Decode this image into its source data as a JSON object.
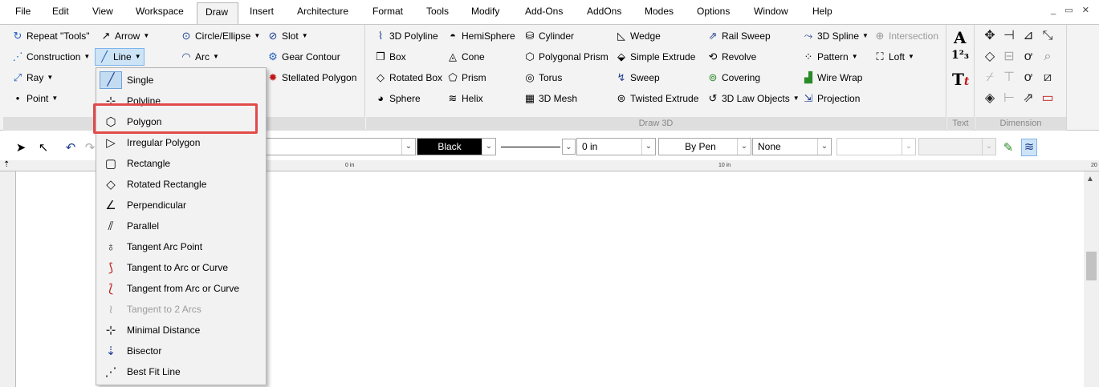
{
  "menubar": {
    "items": [
      "File",
      "Edit",
      "View",
      "Workspace",
      "Draw",
      "Insert",
      "Architecture",
      "Format",
      "Tools",
      "Modify",
      "Add-Ons",
      "AddOns",
      "Modes",
      "Options",
      "Window",
      "Help"
    ],
    "active": "Draw",
    "window_controls": "_ ▭ ✕"
  },
  "ribbon": {
    "draw2d": {
      "repeat": "Repeat \"Tools\"",
      "construction": "Construction",
      "ray": "Ray",
      "point": "Point",
      "arrow": "Arrow",
      "line": "Line",
      "circle": "Circle/Ellipse",
      "arc": "Arc",
      "slot": "Slot",
      "gear": "Gear Contour",
      "stellated": "Stellated Polygon"
    },
    "draw3d": {
      "label": "Draw 3D",
      "col1": [
        "3D Polyline",
        "Box",
        "Rotated Box",
        "Sphere"
      ],
      "col2": [
        "HemiSphere",
        "Cone",
        "Prism",
        "Helix"
      ],
      "col3": [
        "Cylinder",
        "Polygonal Prism",
        "Torus",
        "3D Mesh"
      ],
      "col4": [
        "Wedge",
        "Simple Extrude",
        "Sweep",
        "Twisted Extrude"
      ],
      "col5": [
        "Rail Sweep",
        "Revolve",
        "Covering",
        "3D Law Objects"
      ],
      "col6": [
        "3D Spline",
        "Pattern",
        "Wire Wrap",
        "Projection"
      ],
      "col7": [
        "Intersection",
        "Loft"
      ]
    },
    "text_group": {
      "label": "Text"
    },
    "dimension_group": {
      "label": "Dimension"
    }
  },
  "toolbar": {
    "color": "Black",
    "line_width": "0 in",
    "pen": "By Pen",
    "fill": "None"
  },
  "ruler": {
    "tick0": "0 in",
    "tick10": "10 in",
    "tick20": "20"
  },
  "dropdown": {
    "items": [
      {
        "label": "Single",
        "icon": "single-line-icon"
      },
      {
        "label": "Polyline",
        "icon": "polyline-icon"
      },
      {
        "label": "Polygon",
        "icon": "polygon-icon"
      },
      {
        "label": "Irregular Polygon",
        "icon": "irregular-polygon-icon"
      },
      {
        "label": "Rectangle",
        "icon": "rectangle-icon"
      },
      {
        "label": "Rotated Rectangle",
        "icon": "rotated-rectangle-icon"
      },
      {
        "label": "Perpendicular",
        "icon": "perpendicular-icon"
      },
      {
        "label": "Parallel",
        "icon": "parallel-icon"
      },
      {
        "label": "Tangent Arc Point",
        "icon": "tangent-arc-point-icon"
      },
      {
        "label": "Tangent to Arc or Curve",
        "icon": "tangent-to-arc-icon"
      },
      {
        "label": "Tangent from Arc or Curve",
        "icon": "tangent-from-arc-icon"
      },
      {
        "label": "Tangent to 2 Arcs",
        "icon": "tangent-2-arcs-icon"
      },
      {
        "label": "Minimal Distance",
        "icon": "minimal-distance-icon"
      },
      {
        "label": "Bisector",
        "icon": "bisector-icon"
      },
      {
        "label": "Best Fit Line",
        "icon": "best-fit-line-icon"
      }
    ],
    "highlight_color": "#e24a4a"
  }
}
